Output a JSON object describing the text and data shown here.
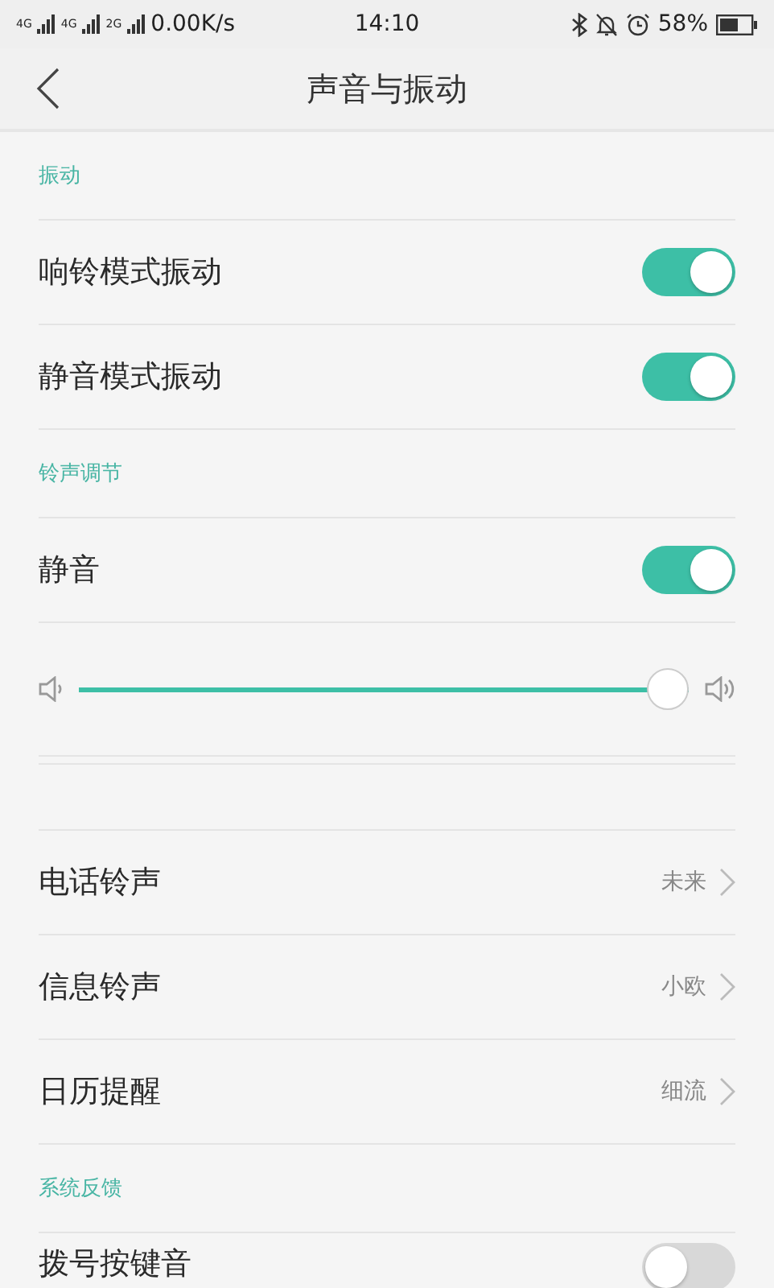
{
  "status_bar": {
    "networks": [
      {
        "label": "4G"
      },
      {
        "label": "4G"
      },
      {
        "label": "2G"
      }
    ],
    "speed": "0.00K/s",
    "time": "14:10",
    "battery": "58%"
  },
  "header": {
    "title": "声音与振动"
  },
  "sections": [
    {
      "kind": "section",
      "title": "振动",
      "rows": [
        {
          "kind": "toggle",
          "label": "响铃模式振动",
          "on": true
        },
        {
          "kind": "toggle",
          "label": "静音模式振动",
          "on": true
        }
      ]
    },
    {
      "kind": "section",
      "title": "铃声调节",
      "rows": [
        {
          "kind": "toggle",
          "label": "静音",
          "on": true
        },
        {
          "kind": "slider",
          "level": 1
        }
      ]
    },
    {
      "kind": "group",
      "rows": [
        {
          "kind": "link",
          "label": "电话铃声",
          "value": "未来"
        },
        {
          "kind": "link",
          "label": "信息铃声",
          "value": "小欧"
        },
        {
          "kind": "link",
          "label": "日历提醒",
          "value": "细流"
        }
      ]
    },
    {
      "kind": "section",
      "title": "系统反馈",
      "rows": [
        {
          "kind": "toggle",
          "label": "拨号按键音",
          "on": false
        }
      ]
    }
  ]
}
